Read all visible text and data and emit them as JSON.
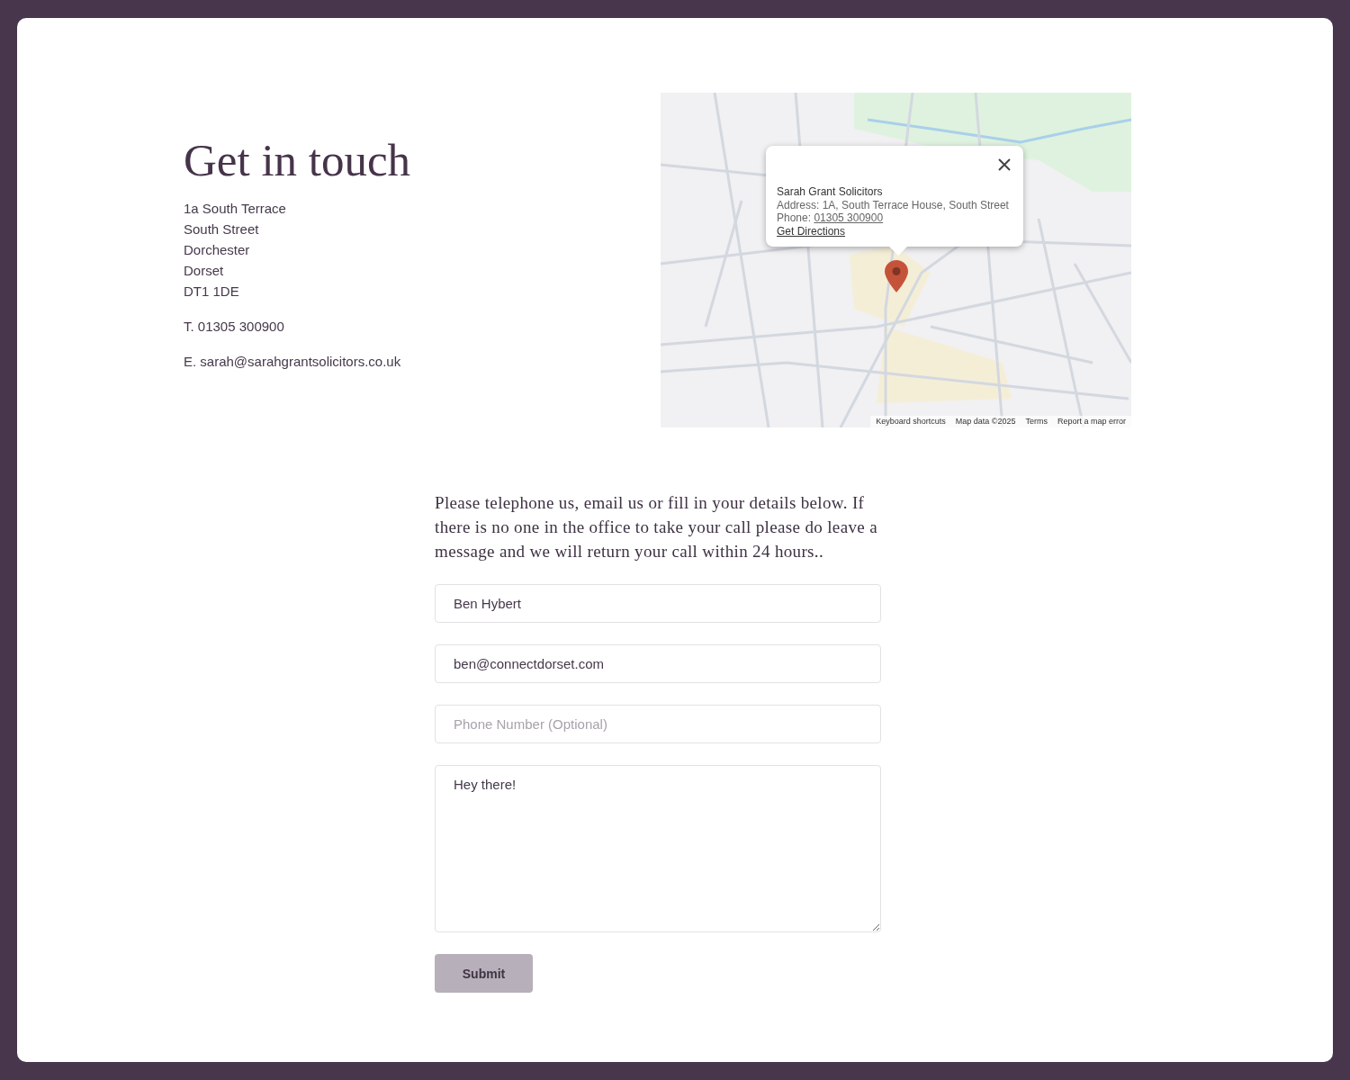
{
  "heading": "Get in touch",
  "address_lines": [
    "1a South Terrace",
    "South Street",
    "Dorchester",
    "Dorset",
    "DT1 1DE"
  ],
  "phone": "T. 01305 300900",
  "email": "E. sarah@sarahgrantsolicitors.co.uk",
  "map": {
    "popup": {
      "title": "Sarah Grant Solicitors",
      "address": "Address: 1A, South Terrace House, South Street",
      "phone_label": "Phone:",
      "phone_link": "01305 300900",
      "directions_link": "Get Directions"
    },
    "footer_links": [
      "Keyboard shortcuts",
      "Map data ©2025",
      "Terms",
      "Report a map error"
    ]
  },
  "form": {
    "intro": "Please telephone us, email us or fill in your details below. If there is no one in the office to take your call please do leave a message and we will return your call within 24 hours..",
    "fields": [
      {
        "kind": "input",
        "value": "Ben Hybert"
      },
      {
        "kind": "input",
        "value": "ben@connectdorset.com"
      },
      {
        "kind": "input",
        "placeholder": "Phone Number (Optional)"
      },
      {
        "kind": "textarea",
        "value": "Hey there!"
      }
    ],
    "submit": "Submit"
  }
}
